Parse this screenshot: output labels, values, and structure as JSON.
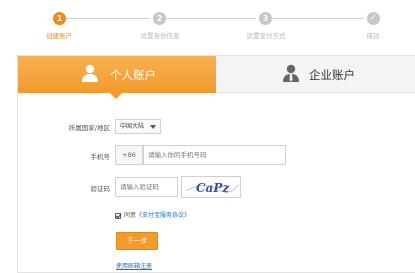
{
  "stepper": {
    "steps": [
      {
        "number": "1",
        "label": "创建账户",
        "active": true
      },
      {
        "number": "2",
        "label": "设置身份信息",
        "active": false
      },
      {
        "number": "3",
        "label": "设置支付方式",
        "active": false
      },
      {
        "number": "✓",
        "label": "成功",
        "active": false
      }
    ]
  },
  "tabs": {
    "personal": "个人账户",
    "enterprise": "企业账户"
  },
  "form": {
    "region_label": "所属国家/地区",
    "region_value": "中国大陆",
    "phone_label": "手机号",
    "phone_prefix": "+86",
    "phone_placeholder": "请输入你的手机号码",
    "code_label": "验证码",
    "code_placeholder": "请输入验证码",
    "captcha_text": "CaPz",
    "agree_prefix": "同意",
    "agree_link": "《支付宝服务协议》",
    "next_button": "下一步",
    "email_register": "使用邮箱注册"
  },
  "colors": {
    "accent": "#f29a2c",
    "link": "#1a6fc6",
    "captcha": "#3b4aa8"
  }
}
